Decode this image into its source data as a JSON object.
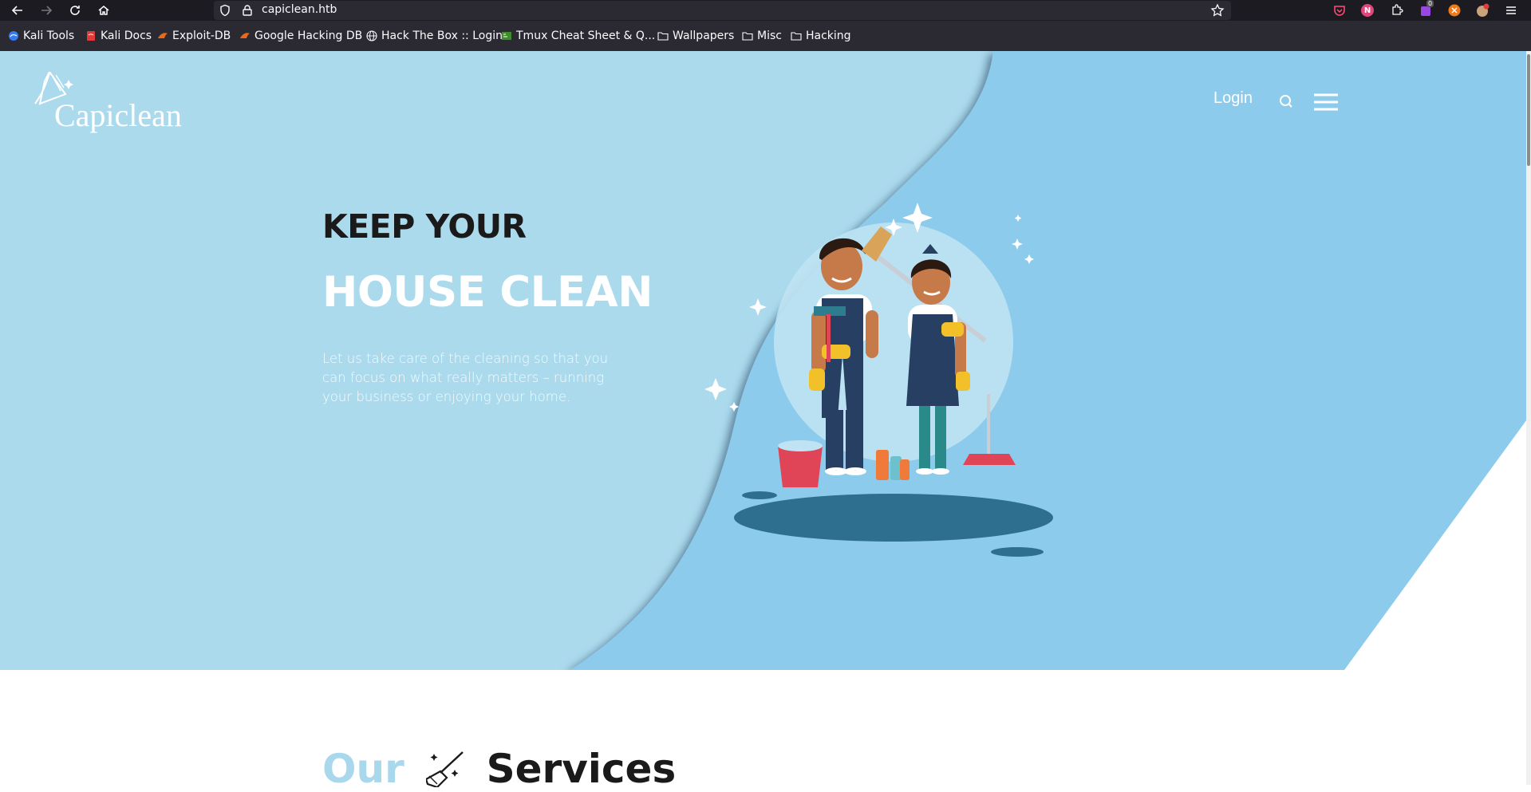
{
  "browser": {
    "url": "capiclean.htb",
    "bookmarks": [
      {
        "label": "Kali Tools",
        "icon": "kali-icon"
      },
      {
        "label": "Kali Docs",
        "icon": "kali-docs-icon"
      },
      {
        "label": "Exploit-DB",
        "icon": "exploit-db-icon"
      },
      {
        "label": "Google Hacking DB",
        "icon": "ghdb-icon"
      },
      {
        "label": "Hack The Box :: Login",
        "icon": "globe-icon"
      },
      {
        "label": "Tmux Cheat Sheet & Q...",
        "icon": "tmux-icon"
      },
      {
        "label": "Wallpapers",
        "icon": "folder-icon"
      },
      {
        "label": "Misc",
        "icon": "folder-icon"
      },
      {
        "label": "Hacking",
        "icon": "folder-icon"
      }
    ],
    "extension_badge": "0",
    "extension_letter": "N"
  },
  "site": {
    "logo_text": "Capiclean",
    "nav": {
      "login": "Login"
    },
    "hero": {
      "line1": "KEEP YOUR",
      "line2": "HOUSE CLEAN",
      "description": "Let us take care of the cleaning so that you can focus on what really matters – running your business or enjoying your home."
    },
    "services": {
      "word1": "Our",
      "word2": "Services"
    }
  },
  "colors": {
    "hero_light": "#acdaed",
    "hero_dark": "#8ccbeb",
    "accent": "#a9d7eb",
    "chrome_dark": "#1c1b22",
    "chrome_mid": "#2b2a33"
  }
}
